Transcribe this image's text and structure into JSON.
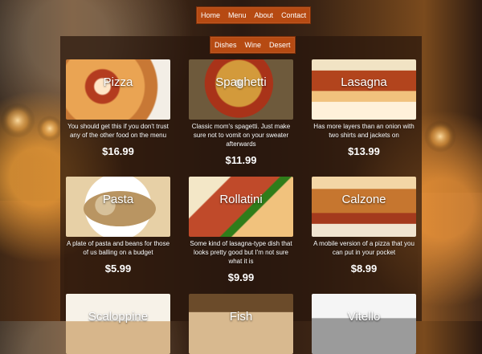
{
  "nav": {
    "top": [
      "Home",
      "Menu",
      "About",
      "Contact"
    ],
    "sub": [
      "Dishes",
      "Wine",
      "Desert"
    ]
  },
  "menu_items": [
    {
      "name": "Pizza",
      "desc": "You should get this if you don't trust any of the other food on the menu",
      "price": "$16.99"
    },
    {
      "name": "Spaghetti",
      "desc": "Classic mom's spagetti. Just make sure not to vomit on your sweater afterwards",
      "price": "$11.99"
    },
    {
      "name": "Lasagna",
      "desc": "Has more layers than an onion with two shirts and jackets on",
      "price": "$13.99"
    },
    {
      "name": "Pasta",
      "desc": "A plate of pasta and beans for those of us balling on a budget",
      "price": "$5.99"
    },
    {
      "name": "Rollatini",
      "desc": "Some kind of lasagna-type dish that looks pretty good but I'm not sure what it is",
      "price": "$9.99"
    },
    {
      "name": "Calzone",
      "desc": "A mobile version of a pizza that you can put in your pocket",
      "price": "$8.99"
    },
    {
      "name": "Scaloppine",
      "desc": "",
      "price": ""
    },
    {
      "name": "Fish",
      "desc": "",
      "price": ""
    },
    {
      "name": "Vitello",
      "desc": "",
      "price": ""
    }
  ]
}
